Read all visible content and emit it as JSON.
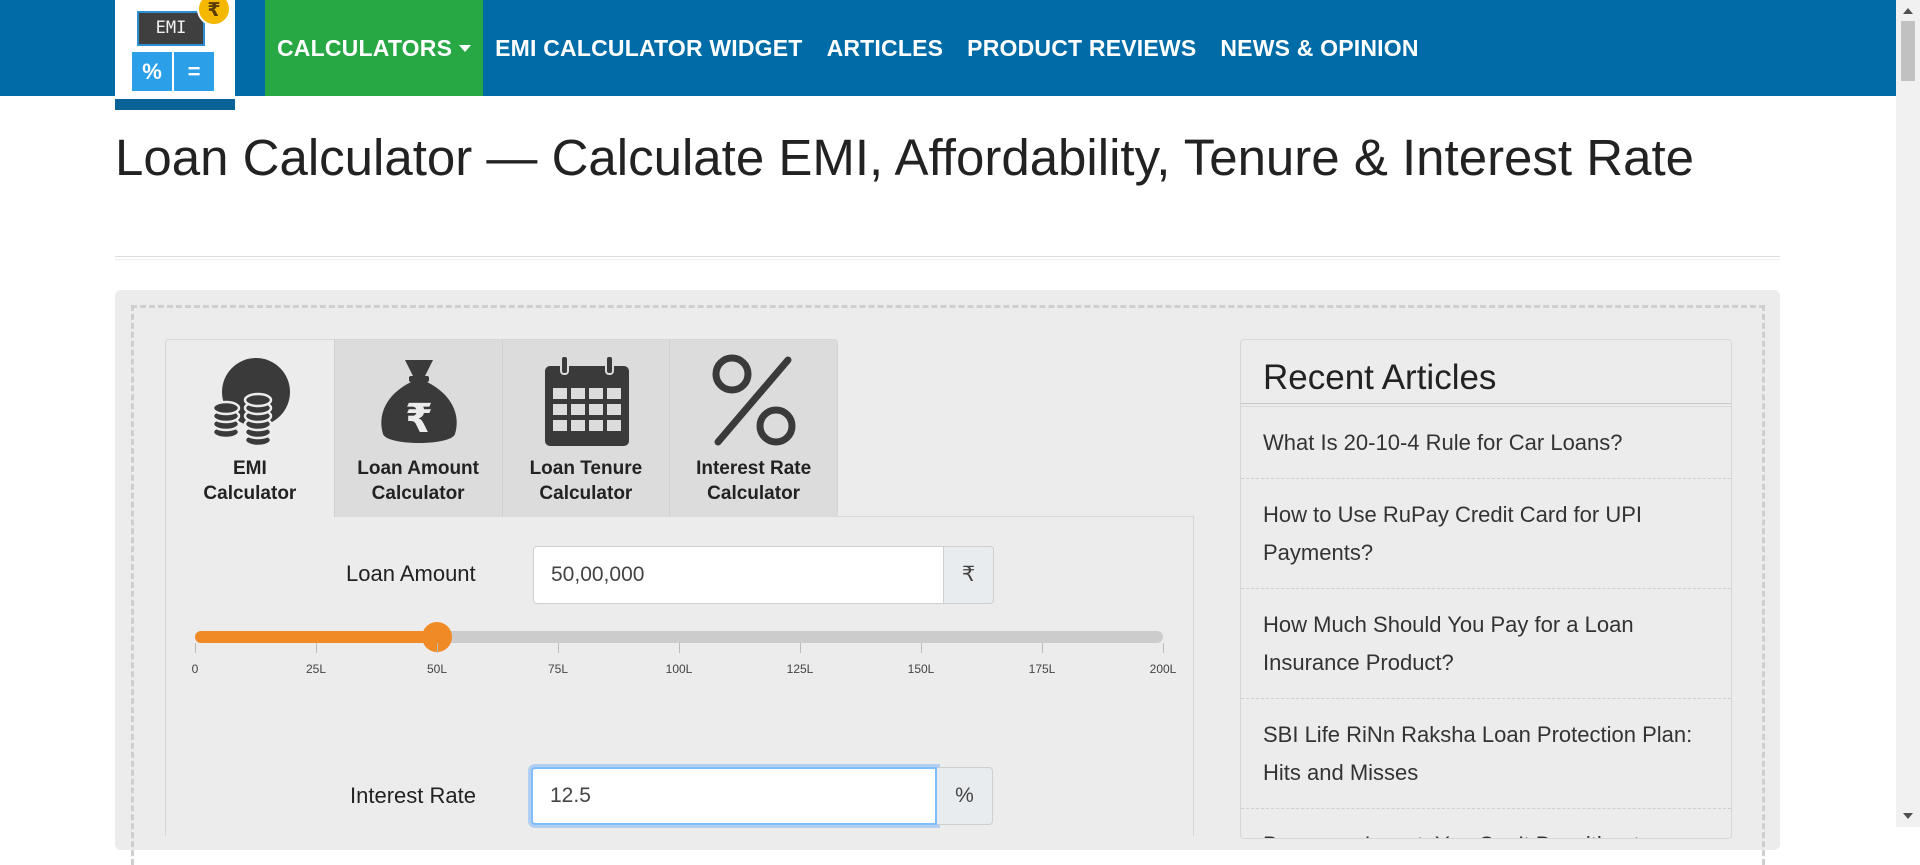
{
  "logo": {
    "screen_text": "EMI",
    "key_left": "%",
    "key_right": "=",
    "coin": "₹"
  },
  "nav": {
    "calculators": "CALCULATORS",
    "items": [
      "EMI CALCULATOR WIDGET",
      "ARTICLES",
      "PRODUCT REVIEWS",
      "NEWS & OPINION"
    ]
  },
  "page_title": "Loan Calculator — Calculate EMI, Affordability, Tenure & Interest Rate",
  "tabs": [
    {
      "line1": "EMI",
      "line2": "Calculator",
      "icon": "coins-icon",
      "active": true
    },
    {
      "line1": "Loan Amount",
      "line2": "Calculator",
      "icon": "money-bag-icon",
      "active": false
    },
    {
      "line1": "Loan Tenure",
      "line2": "Calculator",
      "icon": "calendar-icon",
      "active": false
    },
    {
      "line1": "Interest Rate",
      "line2": "Calculator",
      "icon": "percent-icon",
      "active": false
    }
  ],
  "loan_amount": {
    "label": "Loan Amount",
    "value": "50,00,000",
    "addon": "₹",
    "slider": {
      "min": 0,
      "max": 200,
      "value": 50,
      "ticks": [
        "0",
        "25L",
        "50L",
        "75L",
        "100L",
        "125L",
        "150L",
        "175L",
        "200L"
      ]
    }
  },
  "interest_rate": {
    "label": "Interest Rate",
    "value": "12.5",
    "addon": "%"
  },
  "recent_articles": {
    "title": "Recent Articles",
    "items": [
      "What Is 20-10-4 Rule for Car Loans?",
      "How to Use RuPay Credit Card for UPI Payments?",
      "How Much Should You Pay for a Loan Insurance Product?",
      "SBI Life RiNn Raksha Loan Protection Plan: Hits and Misses",
      "Borrow or Invest: You Can’t Do without"
    ]
  },
  "colors": {
    "navbar": "#006ca7",
    "active_nav": "#28a745",
    "slider": "#f08a24"
  }
}
